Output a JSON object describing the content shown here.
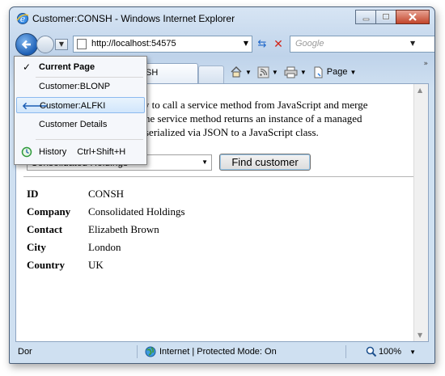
{
  "window": {
    "title": "Customer:CONSH - Windows Internet Explorer"
  },
  "address_bar": {
    "url": "http://localhost:54575",
    "search_placeholder": "Google"
  },
  "tab": {
    "label": "SH"
  },
  "command_bar": {
    "page_label": "Page"
  },
  "history_menu": {
    "items": [
      {
        "label": "Current Page",
        "icon": "checkmark-icon"
      },
      {
        "label": "Customer:BLONP",
        "icon": ""
      },
      {
        "label": "Customer:ALFKI",
        "icon": "back-arrow-icon"
      },
      {
        "label": "Customer Details",
        "icon": ""
      }
    ],
    "history_label": "History",
    "history_shortcut": "Ctrl+Shift+H"
  },
  "page": {
    "intro_lines": [
      "w to call a service method from JavaScript and merge",
      "he service method returns an instance of a managed",
      "serialized via JSON to a JavaScript class."
    ],
    "select_value": "Consolidated Holdings",
    "find_button": "Find customer",
    "details": [
      {
        "label": "ID",
        "value": "CONSH"
      },
      {
        "label": "Company",
        "value": "Consolidated Holdings"
      },
      {
        "label": "Contact",
        "value": "Elizabeth Brown"
      },
      {
        "label": "City",
        "value": "London"
      },
      {
        "label": "Country",
        "value": "UK"
      }
    ]
  },
  "status_bar": {
    "left_text": "Dor",
    "zone_text": "Internet | Protected Mode: On",
    "zoom": "100%"
  },
  "colors": {
    "accent": "#1d5fb5",
    "menu_highlight": "#d1e6fb"
  }
}
